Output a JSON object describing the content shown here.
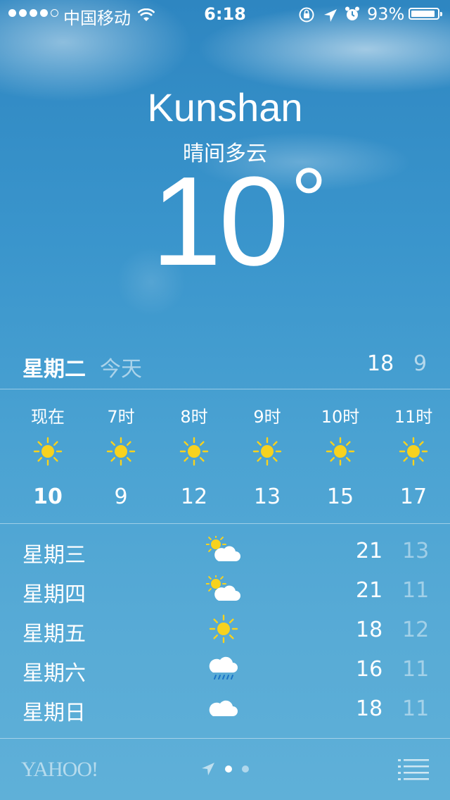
{
  "status_bar": {
    "carrier": "中国移动",
    "time": "6:18",
    "battery_percent_label": "93%",
    "battery_level": 0.93,
    "signal_bars_filled": 4
  },
  "location": {
    "city": "Kunshan",
    "condition": "晴间多云",
    "temperature": "10",
    "degree": "°"
  },
  "today": {
    "day": "星期二",
    "label": "今天",
    "high": "18",
    "low": "9"
  },
  "hourly": [
    {
      "time": "现在",
      "temp": "10",
      "icon": "sun-icon"
    },
    {
      "time": "7时",
      "temp": "9",
      "icon": "sun-icon"
    },
    {
      "time": "8时",
      "temp": "12",
      "icon": "sun-icon"
    },
    {
      "time": "9时",
      "temp": "13",
      "icon": "sun-icon"
    },
    {
      "time": "10时",
      "temp": "15",
      "icon": "sun-icon"
    },
    {
      "time": "11时",
      "temp": "17",
      "icon": "sun-icon"
    }
  ],
  "daily": [
    {
      "day": "星期三",
      "icon": "partly-cloudy-icon",
      "high": "21",
      "low": "13"
    },
    {
      "day": "星期四",
      "icon": "partly-cloudy-icon",
      "high": "21",
      "low": "11"
    },
    {
      "day": "星期五",
      "icon": "sun-icon",
      "high": "18",
      "low": "12"
    },
    {
      "day": "星期六",
      "icon": "rain-icon",
      "high": "16",
      "low": "11"
    },
    {
      "day": "星期日",
      "icon": "cloud-icon",
      "high": "18",
      "low": "11"
    }
  ],
  "footer": {
    "brand": "YAHOO!",
    "page_count": 2,
    "active_page": 1
  },
  "colors": {
    "sun": "#f7d21e",
    "sky_top": "#2e86c1",
    "sky_bottom": "#5fb0d8"
  }
}
